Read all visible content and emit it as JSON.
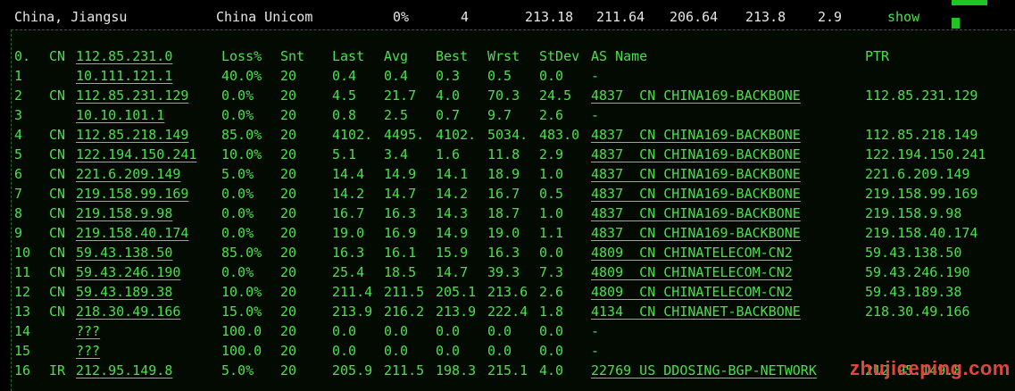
{
  "summary": {
    "location": "China, Jiangsu",
    "isp": "China Unicom",
    "loss": "0%",
    "count": "4",
    "last": "213.18",
    "avg": "211.64",
    "best": "206.64",
    "worst": "213.8",
    "stdev": "2.9",
    "action": "show"
  },
  "table": {
    "headers": {
      "hop": "0.",
      "country": "CN",
      "host": "112.85.231.0",
      "loss": "Loss%",
      "snt": "Snt",
      "last": "Last",
      "avg": "Avg",
      "best": "Best",
      "wrst": "Wrst",
      "stdev": "StDev",
      "as": "AS Name",
      "ptr": "PTR"
    },
    "rows": [
      {
        "hop": "1",
        "country": "",
        "host": "10.111.121.1",
        "loss": "40.0%",
        "snt": "20",
        "last": "0.4",
        "avg": "0.4",
        "best": "0.3",
        "wrst": "0.5",
        "stdev": "0.0",
        "as": "-",
        "ptr": ""
      },
      {
        "hop": "2",
        "country": "CN",
        "host": "112.85.231.129",
        "loss": "0.0%",
        "snt": "20",
        "last": "4.5",
        "avg": "21.7",
        "best": "4.0",
        "wrst": "70.3",
        "stdev": "24.5",
        "as": "4837  CN CHINA169-BACKBONE",
        "ptr": "112.85.231.129"
      },
      {
        "hop": "3",
        "country": "",
        "host": "10.10.101.1",
        "loss": "0.0%",
        "snt": "20",
        "last": "0.8",
        "avg": "2.5",
        "best": "0.7",
        "wrst": "9.7",
        "stdev": "2.6",
        "as": "-",
        "ptr": ""
      },
      {
        "hop": "4",
        "country": "CN",
        "host": "112.85.218.149",
        "loss": "85.0%",
        "snt": "20",
        "last": "4102.",
        "avg": "4495.",
        "best": "4102.",
        "wrst": "5034.",
        "stdev": "483.0",
        "as": "4837  CN CHINA169-BACKBONE",
        "ptr": "112.85.218.149"
      },
      {
        "hop": "5",
        "country": "CN",
        "host": "122.194.150.241",
        "loss": "10.0%",
        "snt": "20",
        "last": "5.1",
        "avg": "3.4",
        "best": "1.6",
        "wrst": "11.8",
        "stdev": "2.9",
        "as": "4837  CN CHINA169-BACKBONE",
        "ptr": "122.194.150.241"
      },
      {
        "hop": "6",
        "country": "CN",
        "host": "221.6.209.149",
        "loss": "5.0%",
        "snt": "20",
        "last": "14.4",
        "avg": "14.9",
        "best": "14.1",
        "wrst": "18.9",
        "stdev": "1.0",
        "as": "4837  CN CHINA169-BACKBONE",
        "ptr": "221.6.209.149"
      },
      {
        "hop": "7",
        "country": "CN",
        "host": "219.158.99.169",
        "loss": "0.0%",
        "snt": "20",
        "last": "14.2",
        "avg": "14.7",
        "best": "14.2",
        "wrst": "16.7",
        "stdev": "0.5",
        "as": "4837  CN CHINA169-BACKBONE",
        "ptr": "219.158.99.169"
      },
      {
        "hop": "8",
        "country": "CN",
        "host": "219.158.9.98",
        "loss": "0.0%",
        "snt": "20",
        "last": "16.7",
        "avg": "16.3",
        "best": "14.3",
        "wrst": "18.7",
        "stdev": "1.0",
        "as": "4837  CN CHINA169-BACKBONE",
        "ptr": "219.158.9.98"
      },
      {
        "hop": "9",
        "country": "CN",
        "host": "219.158.40.174",
        "loss": "0.0%",
        "snt": "20",
        "last": "19.0",
        "avg": "16.9",
        "best": "14.9",
        "wrst": "19.0",
        "stdev": "1.1",
        "as": "4837  CN CHINA169-BACKBONE",
        "ptr": "219.158.40.174"
      },
      {
        "hop": "10",
        "country": "CN",
        "host": "59.43.138.50",
        "loss": "85.0%",
        "snt": "20",
        "last": "16.3",
        "avg": "16.1",
        "best": "15.9",
        "wrst": "16.3",
        "stdev": "0.0",
        "as": "4809  CN CHINATELECOM-CN2",
        "ptr": "59.43.138.50"
      },
      {
        "hop": "11",
        "country": "CN",
        "host": "59.43.246.190",
        "loss": "0.0%",
        "snt": "20",
        "last": "25.4",
        "avg": "18.5",
        "best": "14.7",
        "wrst": "39.3",
        "stdev": "7.3",
        "as": "4809  CN CHINATELECOM-CN2",
        "ptr": "59.43.246.190"
      },
      {
        "hop": "12",
        "country": "CN",
        "host": "59.43.189.38",
        "loss": "10.0%",
        "snt": "20",
        "last": "211.4",
        "avg": "211.5",
        "best": "205.1",
        "wrst": "213.6",
        "stdev": "2.6",
        "as": "4809  CN CHINATELECOM-CN2",
        "ptr": "59.43.189.38"
      },
      {
        "hop": "13",
        "country": "CN",
        "host": "218.30.49.166",
        "loss": "15.0%",
        "snt": "20",
        "last": "213.9",
        "avg": "216.2",
        "best": "213.9",
        "wrst": "222.4",
        "stdev": "1.8",
        "as": "4134  CN CHINANET-BACKBONE",
        "ptr": "218.30.49.166"
      },
      {
        "hop": "14",
        "country": "",
        "host": "???",
        "loss": "100.0",
        "snt": "20",
        "last": "0.0",
        "avg": "0.0",
        "best": "0.0",
        "wrst": "0.0",
        "stdev": "0.0",
        "as": "-",
        "ptr": ""
      },
      {
        "hop": "15",
        "country": "",
        "host": "???",
        "loss": "100.0",
        "snt": "20",
        "last": "0.0",
        "avg": "0.0",
        "best": "0.0",
        "wrst": "0.0",
        "stdev": "0.0",
        "as": "-",
        "ptr": ""
      },
      {
        "hop": "16",
        "country": "IR",
        "host": "212.95.149.8",
        "loss": "5.0%",
        "snt": "20",
        "last": "205.9",
        "avg": "211.5",
        "best": "198.3",
        "wrst": "215.1",
        "stdev": "4.0",
        "as": "22769 US DDOSING-BGP-NETWORK",
        "ptr": "212.95.149.8"
      }
    ]
  },
  "watermark": "zhujiceping.com",
  "colors": {
    "text": "#4ae04a",
    "summary_text": "#e6e6e6",
    "background": "#000000",
    "watermark": "#e0463c"
  }
}
